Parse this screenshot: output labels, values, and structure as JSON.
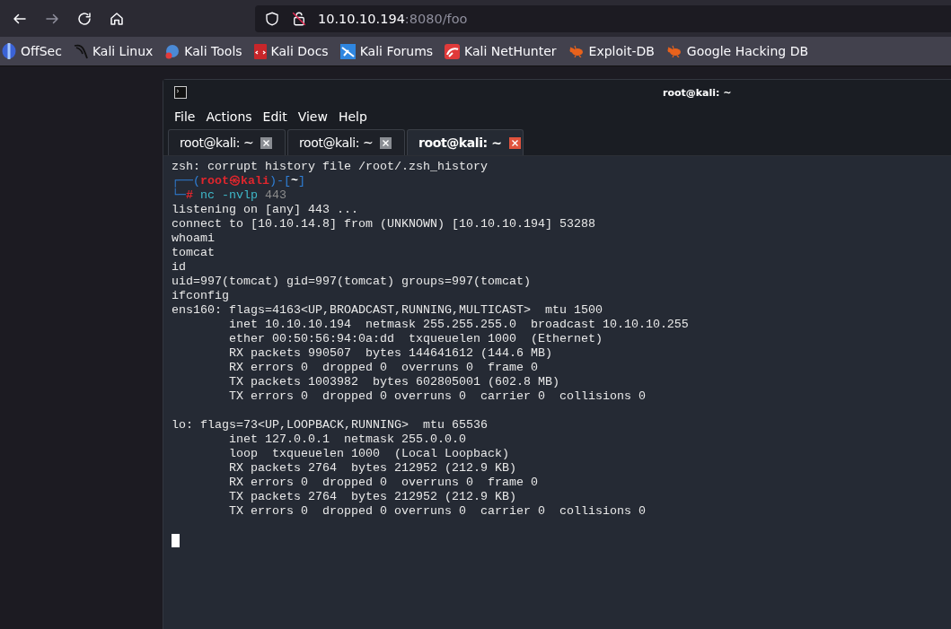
{
  "browser": {
    "nav": [
      {
        "kind": "back",
        "disabled": false
      },
      {
        "kind": "forward",
        "disabled": true
      },
      {
        "kind": "reload",
        "disabled": false
      },
      {
        "kind": "home",
        "disabled": false
      }
    ],
    "url": {
      "host": "10.10.10.194",
      "rest": ":8080/foo"
    },
    "bookmarks": [
      {
        "label": "OffSec",
        "kind": "offsec"
      },
      {
        "label": "Kali Linux",
        "kind": "dragon"
      },
      {
        "label": "Kali Tools",
        "kind": "tools"
      },
      {
        "label": "Kali Docs",
        "kind": "docs"
      },
      {
        "label": "Kali Forums",
        "kind": "forums"
      },
      {
        "label": "Kali NetHunter",
        "kind": "nethunter"
      },
      {
        "label": "Exploit-DB",
        "kind": "bug"
      },
      {
        "label": "Google Hacking DB",
        "kind": "bug"
      }
    ]
  },
  "terminal": {
    "title": "root@kali: ~",
    "menu": [
      "File",
      "Actions",
      "Edit",
      "View",
      "Help"
    ],
    "tabs": [
      {
        "label": "root@kali: ~",
        "selected": false
      },
      {
        "label": "root@kali: ~",
        "selected": false
      },
      {
        "label": "root@kali: ~",
        "selected": true
      }
    ],
    "lines": [
      {
        "kind": "text",
        "text": "zsh: corrupt history file /root/.zsh_history"
      },
      {
        "kind": "prompt",
        "segments": [
          {
            "kind": "frame",
            "text": "┌──("
          },
          {
            "kind": "user",
            "text": "root㉿kali"
          },
          {
            "kind": "frame",
            "text": ")-["
          },
          {
            "kind": "path",
            "text": "~"
          },
          {
            "kind": "frame",
            "text": "]"
          }
        ]
      },
      {
        "kind": "prompt",
        "segments": [
          {
            "kind": "frame",
            "text": "└─"
          },
          {
            "kind": "hash",
            "text": "#"
          },
          {
            "kind": "command",
            "text": " nc -nvlp"
          },
          {
            "kind": "arg",
            "text": " 443"
          }
        ]
      },
      {
        "kind": "text",
        "text": "listening on [any] 443 ..."
      },
      {
        "kind": "text",
        "text": "connect to [10.10.14.8] from (UNKNOWN) [10.10.10.194] 53288"
      },
      {
        "kind": "text",
        "text": "whoami"
      },
      {
        "kind": "text",
        "text": "tomcat"
      },
      {
        "kind": "text",
        "text": "id"
      },
      {
        "kind": "text",
        "text": "uid=997(tomcat) gid=997(tomcat) groups=997(tomcat)"
      },
      {
        "kind": "text",
        "text": "ifconfig"
      },
      {
        "kind": "text",
        "text": "ens160: flags=4163<UP,BROADCAST,RUNNING,MULTICAST>  mtu 1500"
      },
      {
        "kind": "text",
        "text": "        inet 10.10.10.194  netmask 255.255.255.0  broadcast 10.10.10.255"
      },
      {
        "kind": "text",
        "text": "        ether 00:50:56:94:0a:dd  txqueuelen 1000  (Ethernet)"
      },
      {
        "kind": "text",
        "text": "        RX packets 990507  bytes 144641612 (144.6 MB)"
      },
      {
        "kind": "text",
        "text": "        RX errors 0  dropped 0  overruns 0  frame 0"
      },
      {
        "kind": "text",
        "text": "        TX packets 1003982  bytes 602805001 (602.8 MB)"
      },
      {
        "kind": "text",
        "text": "        TX errors 0  dropped 0 overruns 0  carrier 0  collisions 0"
      },
      {
        "kind": "blank"
      },
      {
        "kind": "text",
        "text": "lo: flags=73<UP,LOOPBACK,RUNNING>  mtu 65536"
      },
      {
        "kind": "text",
        "text": "        inet 127.0.0.1  netmask 255.0.0.0"
      },
      {
        "kind": "text",
        "text": "        loop  txqueuelen 1000  (Local Loopback)"
      },
      {
        "kind": "text",
        "text": "        RX packets 2764  bytes 212952 (212.9 KB)"
      },
      {
        "kind": "text",
        "text": "        RX errors 0  dropped 0  overruns 0  frame 0"
      },
      {
        "kind": "text",
        "text": "        TX packets 2764  bytes 212952 (212.9 KB)"
      },
      {
        "kind": "text",
        "text": "        TX errors 0  dropped 0 overruns 0  carrier 0  collisions 0"
      },
      {
        "kind": "blank"
      },
      {
        "kind": "cursor"
      }
    ]
  }
}
